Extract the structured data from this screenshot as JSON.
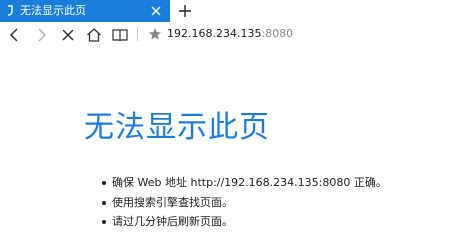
{
  "tab": {
    "title": "无法显示此页",
    "icon": "edge-page-icon",
    "close_icon": "close-icon"
  },
  "toolbar": {
    "url_host": "192.168.234.135",
    "url_port": ":8080"
  },
  "error": {
    "title": "无法显示此页",
    "bullets": [
      "确保 Web 地址 http://192.168.234.135:8080 正确。",
      "使用搜索引擎查找页面。",
      "请过几分钟后刷新页面。"
    ]
  },
  "colors": {
    "accent": "#1a7fdc",
    "text": "#222222",
    "muted": "#8a8a8a"
  }
}
